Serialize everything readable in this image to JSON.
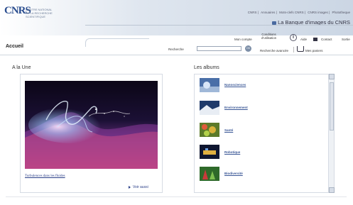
{
  "header": {
    "logo_text": "CNRS",
    "logo_subtext": "CENTRE NATIONAL DE LA RECHERCHE SCIENTIFIQUE",
    "top_links": [
      "CNRS",
      "Annuaires",
      "Mots-clefs CNRS",
      "CNRS images",
      "Phototheque"
    ],
    "site_title": "La Banque d'images du CNRS"
  },
  "nav": {
    "breadcrumb": "Accueil",
    "search_label": "Recherche",
    "search_value": "",
    "go_label": "OK",
    "mon_compte": "Mon compte",
    "conditions_line1": "Conditions",
    "conditions_line2": "d'utilisation",
    "aide": "Aide",
    "contact": "Contact",
    "sortie": "Sortie",
    "advanced_search": "Recherche avancée",
    "mes_paniers": "Mes paniers"
  },
  "featured": {
    "title": "A la Une",
    "caption": "Turbulences dans les fluides",
    "more_link": "Voir aussi"
  },
  "albums": {
    "title": "Les albums",
    "items": [
      {
        "label": "Nanosciences"
      },
      {
        "label": "Environnement"
      },
      {
        "label": "Santé"
      },
      {
        "label": "Robotique"
      },
      {
        "label": "Biodiversité"
      }
    ]
  },
  "colors": {
    "link": "#2a3f88",
    "header_gradient_end": "#cbd6e4"
  }
}
